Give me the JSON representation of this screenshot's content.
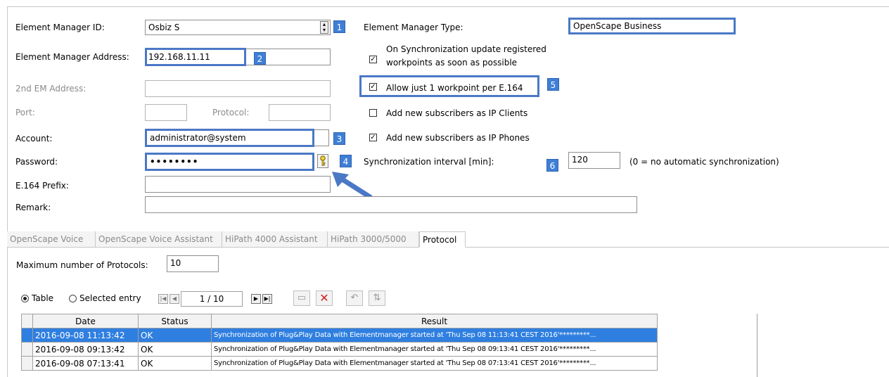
{
  "form": {
    "em_id_label": "Element Manager ID:",
    "em_id_value": "Osbiz S",
    "em_address_label": "Element Manager Address:",
    "em_address_value": "192.168.11.11",
    "second_address_label": "2nd EM Address:",
    "port_label": "Port:",
    "protocol_label": "Protocol:",
    "account_label": "Account:",
    "account_value": "administrator@system",
    "password_label": "Password:",
    "password_value": "••••••••",
    "prefix_label": "E.164 Prefix:",
    "remark_label": "Remark:"
  },
  "right": {
    "em_type_label": "Element Manager Type:",
    "em_type_value": "OpenScape Business",
    "opt_sync_update_line1": "On Synchronization update registered",
    "opt_sync_update_line2": "workpoints as soon as possible",
    "opt_allow_one": "Allow just 1 workpoint per E.164",
    "opt_ip_clients": "Add new subscribers as IP Clients",
    "opt_ip_phones": "Add new subscribers as IP Phones",
    "sync_interval_label": "Synchronization interval [min]:",
    "sync_interval_value": "120",
    "sync_interval_hint": "(0 = no automatic synchronization)"
  },
  "checks": {
    "sync_update": "true",
    "allow_one": "true",
    "ip_clients": "false",
    "ip_phones": "true"
  },
  "badges": [
    "1",
    "2",
    "3",
    "4",
    "5",
    "6"
  ],
  "tabs": [
    "OpenScape Voice",
    "OpenScape Voice Assistant",
    "HiPath 4000 Assistant",
    "HiPath 3000/5000",
    "Protocol"
  ],
  "protocol": {
    "max_label": "Maximum number of Protocols:",
    "max_value": "10",
    "radio_table": "Table",
    "radio_selected": "Selected entry",
    "page_indicator": "1 / 10"
  },
  "grid": {
    "headers": [
      "Date",
      "Status",
      "Result"
    ],
    "rows": [
      {
        "date": "2016-09-08 11:13:42",
        "status": "OK",
        "result": "Synchronization of Plug&Play Data with Elementmanager started at 'Thu Sep 08 11:13:41 CEST 2016'*********..."
      },
      {
        "date": "2016-09-08 09:13:42",
        "status": "OK",
        "result": "Synchronization of Plug&Play Data with Elementmanager started at 'Thu Sep 08 09:13:41 CEST 2016'*********..."
      },
      {
        "date": "2016-09-08 07:13:41",
        "status": "OK",
        "result": "Synchronization of Plug&Play Data with Elementmanager started at 'Thu Sep 08 07:13:41 CEST 2016'*********..."
      }
    ]
  },
  "colors": {
    "highlight": "#4a78c6",
    "badge": "#3f7fd6",
    "selection": "#2f7fe0"
  },
  "icons": [
    "dropdown-icon",
    "key-icon",
    "arrow-icon",
    "first-page-icon",
    "prev-page-icon",
    "next-page-icon",
    "last-page-icon",
    "save-icon",
    "delete-icon",
    "undo-icon",
    "sort-icon"
  ]
}
